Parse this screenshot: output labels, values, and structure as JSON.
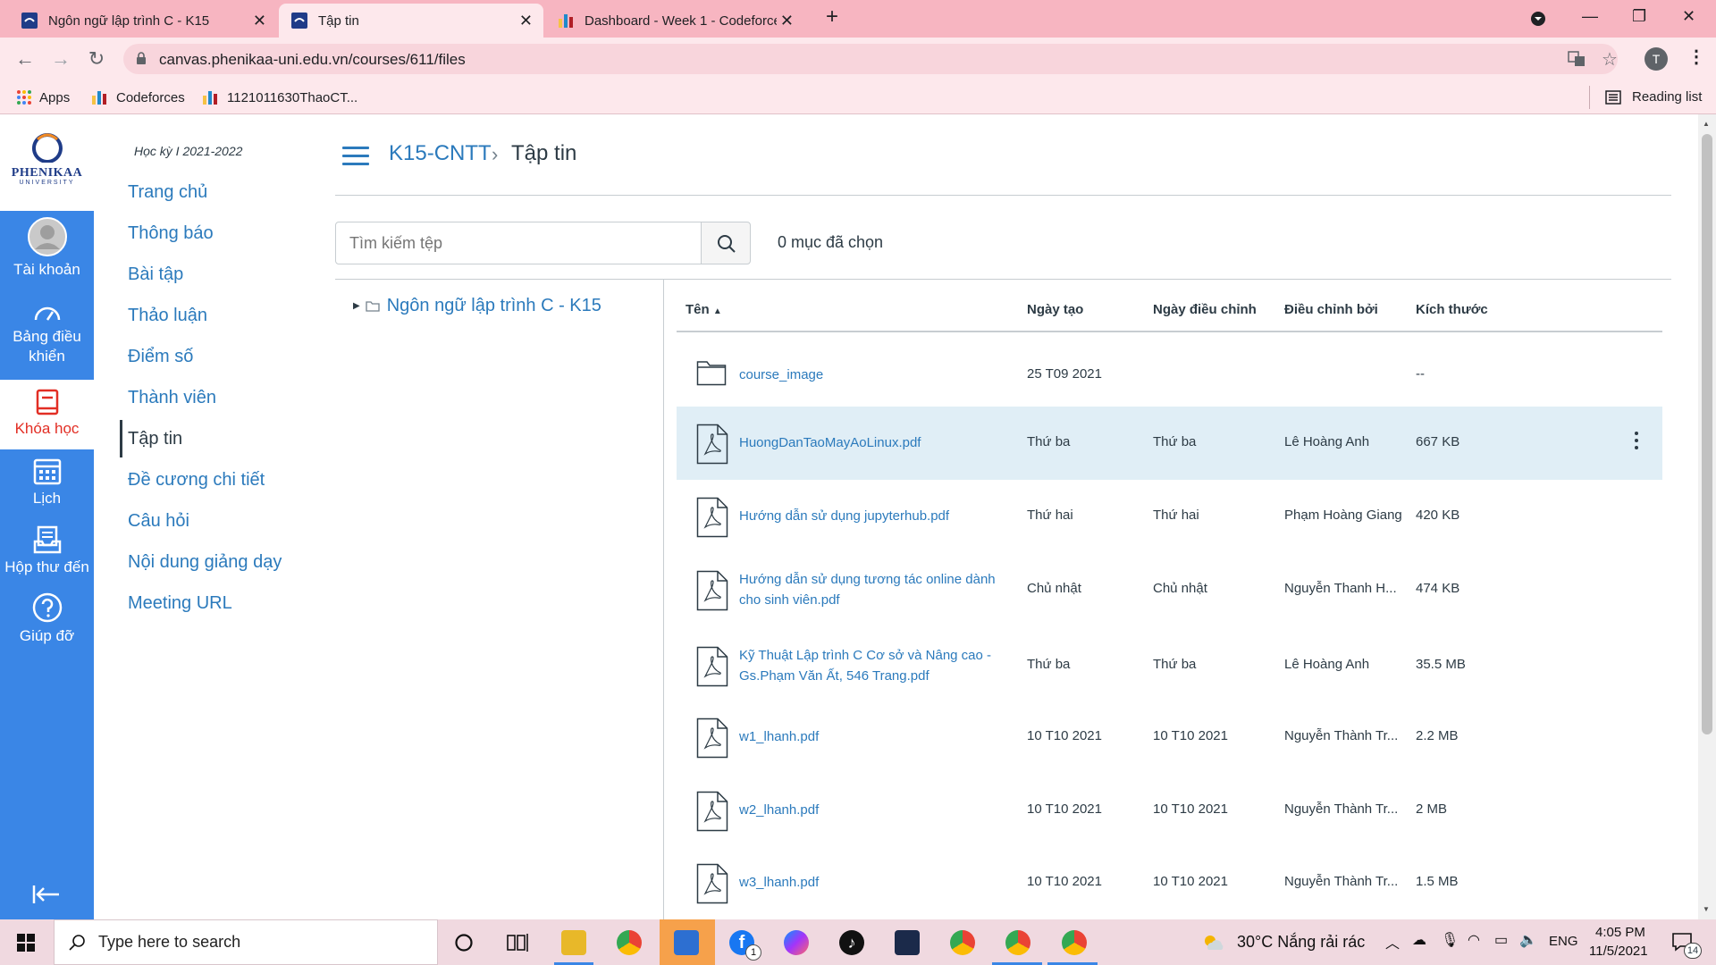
{
  "browser": {
    "tabs": [
      {
        "title": "Ngôn ngữ lập trình C - K15"
      },
      {
        "title": "Tập tin"
      },
      {
        "title": "Dashboard - Week 1 - Codeforces"
      }
    ],
    "url": "canvas.phenikaa-uni.edu.vn/courses/611/files",
    "bookmarks": [
      "Apps",
      "Codeforces",
      "1121011630ThaoCT..."
    ],
    "reading_list": "Reading list",
    "profile_initial": "T"
  },
  "global_nav": {
    "logo_text": "PHENIKAA",
    "logo_sub": "UNIVERSITY",
    "items": [
      {
        "label": "Tài khoản"
      },
      {
        "label": "Bảng điều khiển"
      },
      {
        "label": "Khóa học"
      },
      {
        "label": "Lịch"
      },
      {
        "label": "Hộp thư đến"
      },
      {
        "label": "Giúp đỡ"
      }
    ]
  },
  "course_nav": {
    "term": "Học kỳ I 2021-2022",
    "items": [
      {
        "label": "Trang chủ"
      },
      {
        "label": "Thông báo"
      },
      {
        "label": "Bài tập"
      },
      {
        "label": "Thảo luận"
      },
      {
        "label": "Điểm số"
      },
      {
        "label": "Thành viên"
      },
      {
        "label": "Tập tin"
      },
      {
        "label": "Đề cương chi tiết"
      },
      {
        "label": "Câu hỏi"
      },
      {
        "label": "Nội dung giảng dạy"
      },
      {
        "label": "Meeting URL"
      }
    ]
  },
  "breadcrumb": {
    "course": "K15-CNTT",
    "separator": "›",
    "current": "Tập tin"
  },
  "search": {
    "placeholder": "Tìm kiếm tệp"
  },
  "selection": "0 mục đã chọn",
  "folder_tree": {
    "root": "Ngôn ngữ lập trình C - K15"
  },
  "table": {
    "headers": {
      "name": "Tên",
      "created": "Ngày tạo",
      "modified": "Ngày điều chỉnh",
      "modified_by": "Điều chỉnh bởi",
      "size": "Kích thước"
    },
    "rows": [
      {
        "type": "folder",
        "name": "course_image",
        "created": "25 T09 2021",
        "modified": "",
        "modified_by": "",
        "size": "--"
      },
      {
        "type": "pdf",
        "name": "HuongDanTaoMayAoLinux.pdf",
        "created": "Thứ ba",
        "modified": "Thứ ba",
        "modified_by": "Lê Hoàng Anh",
        "size": "667 KB"
      },
      {
        "type": "pdf",
        "name": "Hướng dẫn sử dụng jupyterhub.pdf",
        "created": "Thứ hai",
        "modified": "Thứ hai",
        "modified_by": "Phạm Hoàng Giang",
        "size": "420 KB"
      },
      {
        "type": "pdf",
        "name": "Hướng dẫn sử dụng tương tác online dành cho sinh viên.pdf",
        "created": "Chủ nhật",
        "modified": "Chủ nhật",
        "modified_by": "Nguyễn Thanh H...",
        "size": "474 KB"
      },
      {
        "type": "pdf",
        "name": "Kỹ Thuật Lập trình C Cơ sở và Nâng cao - Gs.Phạm Văn Ất, 546 Trang.pdf",
        "created": "Thứ ba",
        "modified": "Thứ ba",
        "modified_by": "Lê Hoàng Anh",
        "size": "35.5 MB"
      },
      {
        "type": "pdf",
        "name": "w1_lhanh.pdf",
        "created": "10 T10 2021",
        "modified": "10 T10 2021",
        "modified_by": "Nguyễn Thành Tr...",
        "size": "2.2 MB"
      },
      {
        "type": "pdf",
        "name": "w2_lhanh.pdf",
        "created": "10 T10 2021",
        "modified": "10 T10 2021",
        "modified_by": "Nguyễn Thành Tr...",
        "size": "2 MB"
      },
      {
        "type": "pdf",
        "name": "w3_lhanh.pdf",
        "created": "10 T10 2021",
        "modified": "10 T10 2021",
        "modified_by": "Nguyễn Thành Tr...",
        "size": "1.5 MB"
      }
    ]
  },
  "taskbar": {
    "search_placeholder": "Type here to search",
    "weather": "30°C  Nắng rải rác",
    "lang": "ENG",
    "time": "4:05 PM",
    "date": "11/5/2021",
    "notifications": "14",
    "messenger_badge": "1"
  },
  "colors": {
    "canvas_blue": "#3a86e6",
    "link": "#2b7abc",
    "active_red": "#e22e24",
    "selected_row": "#e0eef6",
    "tab_bar": "#f7b5c1"
  }
}
